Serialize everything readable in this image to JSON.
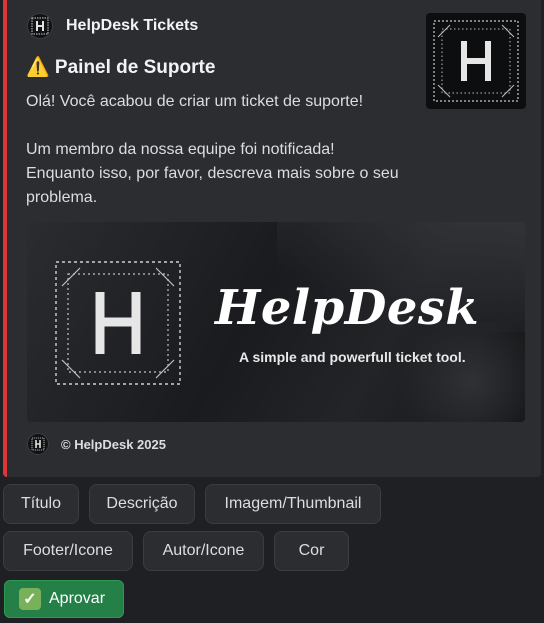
{
  "embed": {
    "author": {
      "name": "HelpDesk Tickets",
      "icon": "helpdesk-logo"
    },
    "title": "⚠️ Painel de Suporte",
    "description": "Olá! Você acabou de criar um ticket de suporte!\n\nUm membro da nossa equipe foi notificada! Enquanto isso, por favor, descreva mais sobre o seu problema.",
    "banner": {
      "title": "HelpDesk",
      "subtitle": "A simple and powerfull ticket tool."
    },
    "footer": {
      "text": "© HelpDesk 2025",
      "icon": "helpdesk-logo"
    },
    "accent_color": "#da373c"
  },
  "buttons": {
    "row1": [
      "Título",
      "Descrição",
      "Imagem/Thumbnail"
    ],
    "row2": [
      "Footer/Icone",
      "Autor/Icone",
      "Cor"
    ],
    "approve": {
      "label": "Aprovar",
      "icon": "check-mark-icon",
      "color": "#248046"
    }
  }
}
